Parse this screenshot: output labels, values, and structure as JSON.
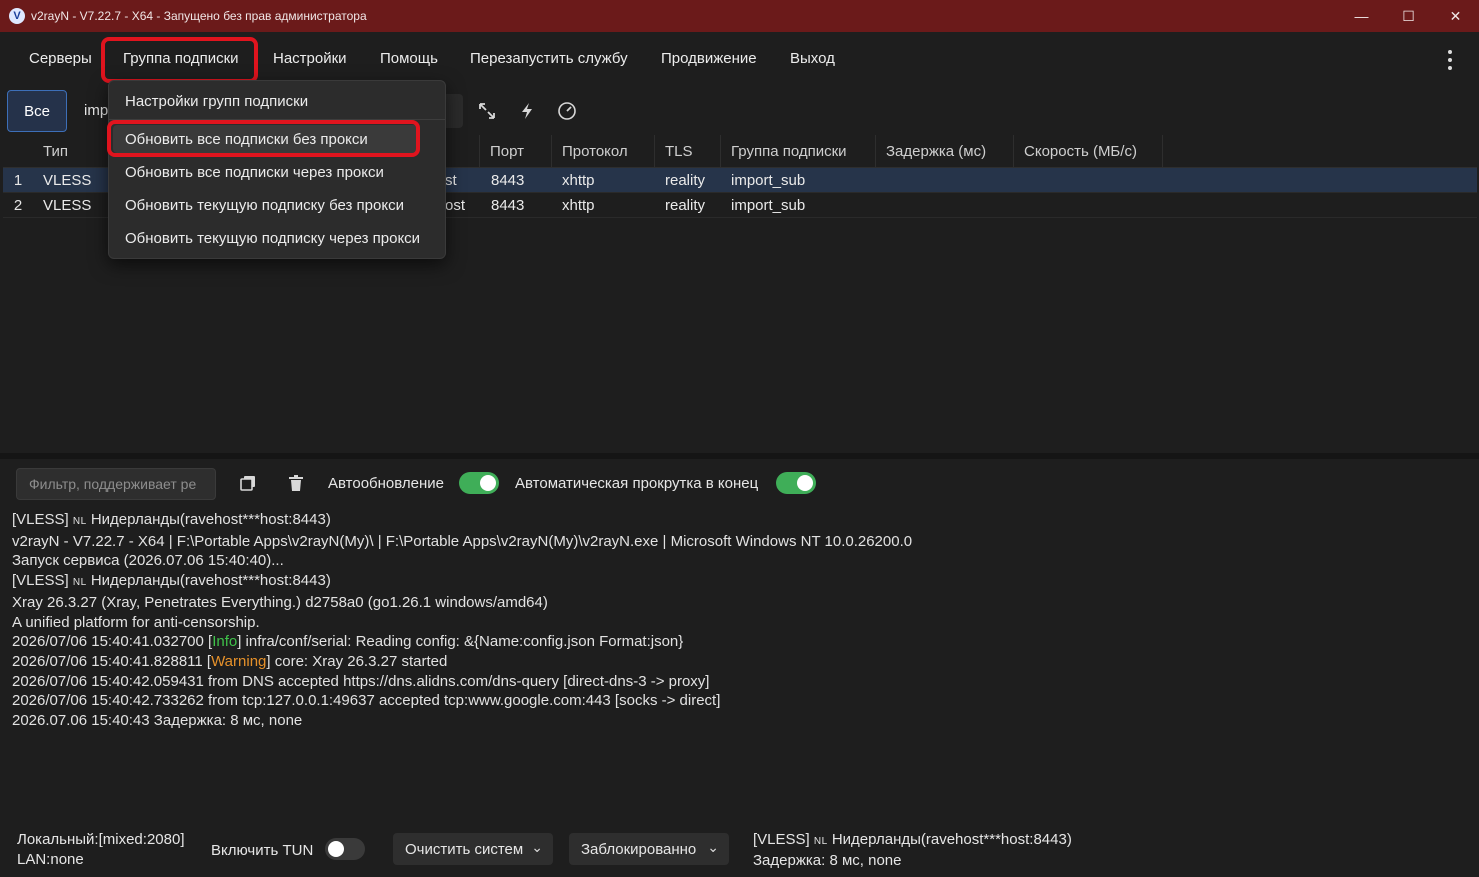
{
  "window": {
    "title": "v2rayN - V7.22.7 - X64 - Запущено без прав администратора",
    "logo_icon": "v2rayn-logo-icon",
    "controls": [
      "minimize",
      "maximize",
      "close"
    ]
  },
  "menu": {
    "servers": "Серверы",
    "subscription_group": "Группа подписки",
    "settings": "Настройки",
    "help": "Помощь",
    "restart_service": "Перезапустить службу",
    "promotion": "Продвижение",
    "exit": "Выход",
    "more_icon": "vertical-dots-icon"
  },
  "toolbar": {
    "all_button": "Все",
    "tab_import": "imp",
    "icons": [
      "expand-icon",
      "lightning-icon",
      "speedometer-icon"
    ]
  },
  "subscription_menu": {
    "items": [
      "Настройки групп подписки",
      "Обновить все подписки без прокси",
      "Обновить все подписки через прокси",
      "Обновить текущую подписку без прокси",
      "Обновить текущую подписку через прокси"
    ],
    "highlighted_index": 1
  },
  "server_table": {
    "columns": [
      "Тип",
      "Порт",
      "Протокол",
      "TLS",
      "Группа подписки",
      "Задержка (мс)",
      "Скорость (МБ/с)"
    ],
    "rows": [
      {
        "num": "1",
        "type": "VLESS",
        "address_tail": "st",
        "port": "8443",
        "protocol": "xhttp",
        "tls": "reality",
        "group": "import_sub",
        "latency": "",
        "speed": ""
      },
      {
        "num": "2",
        "type": "VLESS",
        "address_tail": "ost",
        "port": "8443",
        "protocol": "xhttp",
        "tls": "reality",
        "group": "import_sub",
        "latency": "",
        "speed": ""
      }
    ],
    "selected_row": 0
  },
  "log_toolbar": {
    "filter_placeholder": "Фильтр, поддерживает ре",
    "copy_icon": "copy-icon",
    "delete_icon": "trash-icon",
    "auto_update_label": "Автообновление",
    "auto_update_on": true,
    "auto_scroll_label": "Автоматическая прокрутка в конец",
    "auto_scroll_on": true
  },
  "log": {
    "lines": [
      {
        "before": "[VLESS] ",
        "flag": "NL",
        "after": " Нидерланды(ravehost***host:8443)"
      },
      {
        "text": "v2rayN - V7.22.7 - X64 | F:\\Portable Apps\\v2rayN(My)\\ | F:\\Portable Apps\\v2rayN(My)\\v2rayN.exe | Microsoft Windows NT 10.0.26200.0"
      },
      {
        "text": "Запуск сервиса (2026.07.06 15:40:40)..."
      },
      {
        "before": "[VLESS] ",
        "flag": "NL",
        "after": " Нидерланды(ravehost***host:8443)"
      },
      {
        "text": "Xray 26.3.27 (Xray, Penetrates Everything.) d2758a0 (go1.26.1 windows/amd64)"
      },
      {
        "text": "A unified platform for anti-censorship."
      },
      {
        "before": "2026/07/06 15:40:41.032700 [",
        "tag": "Info",
        "tag_class": "info",
        "after": "] infra/conf/serial: Reading config: &{Name:config.json Format:json}"
      },
      {
        "before": "2026/07/06 15:40:41.828811 [",
        "tag": "Warning",
        "tag_class": "warn",
        "after": "] core: Xray 26.3.27 started"
      },
      {
        "text": "2026/07/06 15:40:42.059431 from DNS accepted https://dns.alidns.com/dns-query [direct-dns-3 -> proxy]"
      },
      {
        "text": "2026/07/06 15:40:42.733262 from tcp:127.0.0.1:49637 accepted tcp:www.google.com:443 [socks -> direct]"
      },
      {
        "text": "2026.07.06 15:40:43 Задержка: 8 мс, none"
      }
    ]
  },
  "status": {
    "local": "Локальный:[mixed:2080]",
    "lan": "LAN:none",
    "tun_label": "Включить TUN",
    "tun_on": false,
    "system_proxy_combo": "Очистить систем",
    "routing_combo": "Заблокированно",
    "current_server_before": "[VLESS] ",
    "current_server_flag": "NL",
    "current_server_after": " Нидерланды(ravehost***host:8443)",
    "latency": "Задержка: 8 мс, none"
  }
}
